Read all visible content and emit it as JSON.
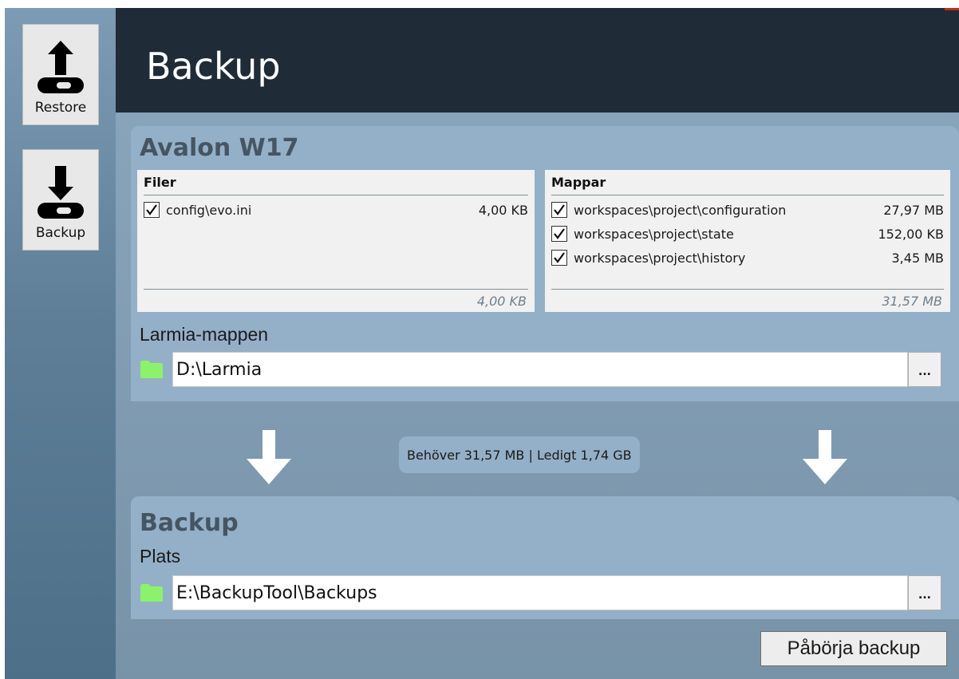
{
  "sidebar": {
    "items": [
      {
        "label": "Restore",
        "icon": "upload-drive-icon"
      },
      {
        "label": "Backup",
        "icon": "download-drive-icon"
      }
    ]
  },
  "header": {
    "title": "Backup"
  },
  "source": {
    "title": "Avalon W17",
    "files": {
      "heading": "Filer",
      "items": [
        {
          "name": "config\\evo.ini",
          "size": "4,00 KB",
          "checked": true
        }
      ],
      "total": "4,00 KB"
    },
    "folders": {
      "heading": "Mappar",
      "items": [
        {
          "name": "workspaces\\project\\configuration",
          "size": "27,97 MB",
          "checked": true
        },
        {
          "name": "workspaces\\project\\state",
          "size": "152,00 KB",
          "checked": true
        },
        {
          "name": "workspaces\\project\\history",
          "size": "3,45 MB",
          "checked": true
        }
      ],
      "total": "31,57 MB"
    },
    "folder_label": "Larmia-mappen",
    "folder_path": "D:\\Larmia",
    "browse_label": "..."
  },
  "status": {
    "text": "Behöver 31,57 MB | Ledigt 1,74 GB"
  },
  "destination": {
    "title": "Backup",
    "location_label": "Plats",
    "path": "E:\\BackupTool\\Backups",
    "browse_label": "..."
  },
  "actions": {
    "start_label": "Påbörja backup"
  },
  "colors": {
    "header_bg": "#1f2b37",
    "panel_bg": "#94b0c8",
    "folder_green": "#8cf26a",
    "title_text": "#455563"
  }
}
